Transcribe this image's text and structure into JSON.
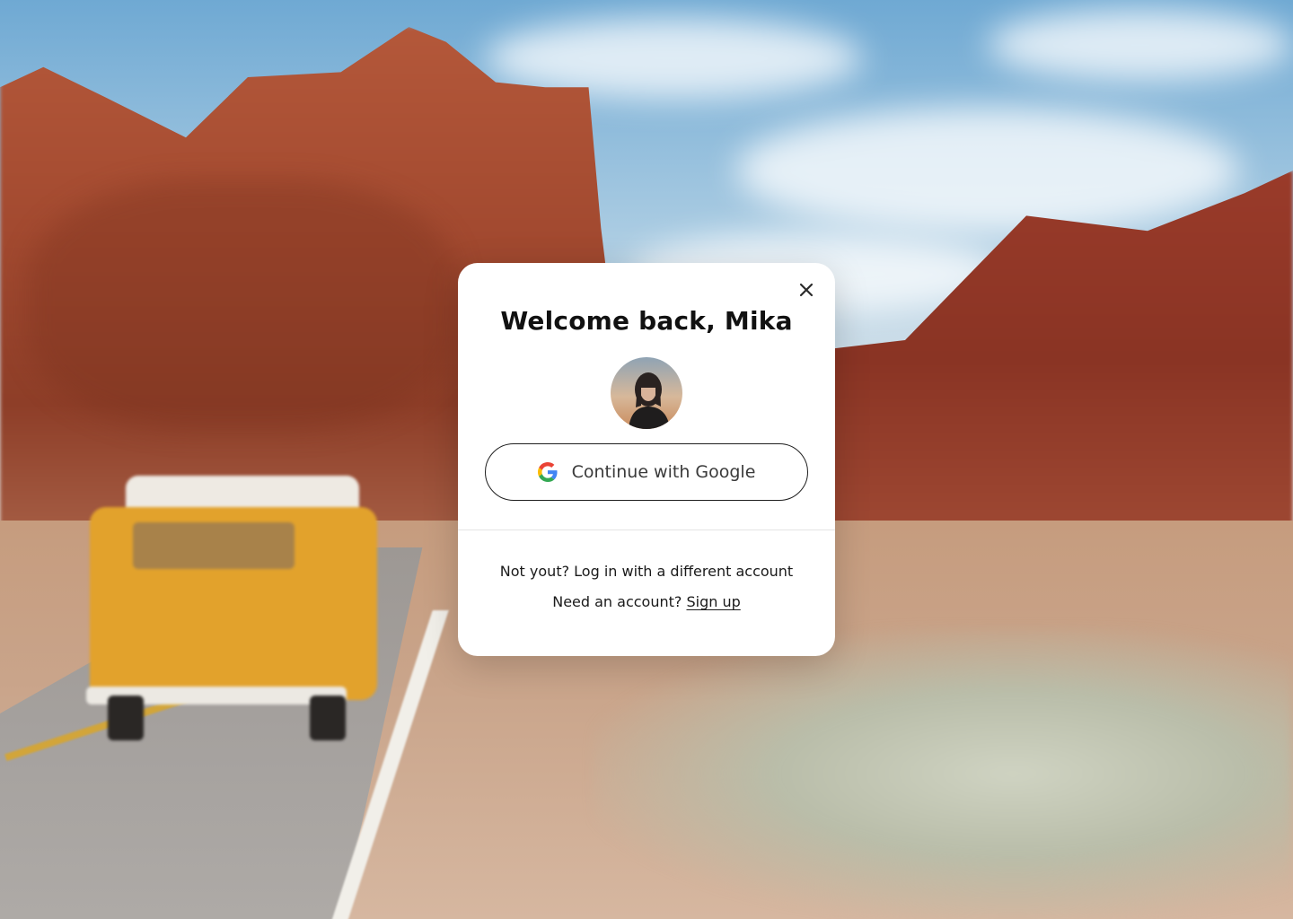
{
  "modal": {
    "title": "Welcome back, Mika",
    "close_icon": "close-icon",
    "avatar_alt": "Mika avatar",
    "google_button_label": "Continue with Google",
    "google_icon": "google-g-icon",
    "alt_account_text": "Not yout? Log in with a different account",
    "signup_prompt": "Need an account?",
    "signup_link": "Sign up"
  },
  "colors": {
    "modal_bg": "#ffffff",
    "text_primary": "#111111",
    "button_border": "#1f1f1f",
    "google_blue": "#4285F4",
    "google_red": "#EA4335",
    "google_yellow": "#FBBC05",
    "google_green": "#34A853"
  }
}
